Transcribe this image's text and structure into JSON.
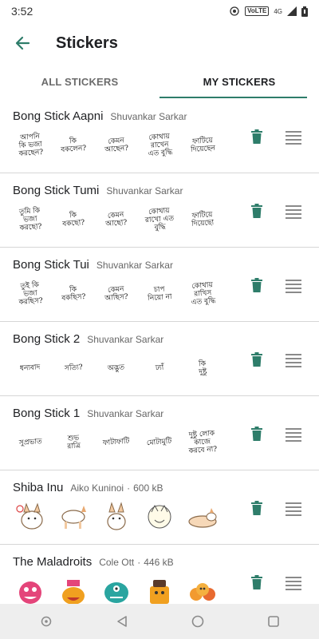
{
  "status_bar": {
    "time": "3:52",
    "volte": "VoLTE",
    "net": "4G"
  },
  "app_bar": {
    "title": "Stickers"
  },
  "tabs": [
    {
      "label": "ALL STICKERS",
      "active": false
    },
    {
      "label": "MY STICKERS",
      "active": true
    }
  ],
  "colors": {
    "accent": "#2e7d6a",
    "delete": "#2e7d6a",
    "divider": "#d6d6d6",
    "nav_bg": "#eeeeee"
  },
  "packs": [
    {
      "name": "Bong Stick Aapni",
      "author": "Shuvankar Sarkar",
      "size": "",
      "stickers": [
        "আপনি\nকি ভজা\nকরছেন?",
        "কি\nবকলেন?",
        "কেমন\nআছেন?",
        "কোথায়\nরাখেন\nএত বুদ্ধি",
        "ফাটিয়ে\nদিয়েছেন"
      ]
    },
    {
      "name": "Bong Stick Tumi",
      "author": "Shuvankar Sarkar",
      "size": "",
      "stickers": [
        "তুমি কি\nভজা\nকরছো?",
        "কি\nবকছো?",
        "কেমন\nআছো?",
        "কোথায়\nরাখো এত\nবুদ্ধি",
        "ফাটিয়ে\nদিয়েছো"
      ]
    },
    {
      "name": "Bong Stick Tui",
      "author": "Shuvankar Sarkar",
      "size": "",
      "stickers": [
        "তুই কি\nভজা\nকরছিস?",
        "কি\nবকছিস?",
        "কেমন\nআছিস?",
        "চাপ\nনিয়ো না",
        "কোথায়\nরাখিস\nএত বুদ্ধি"
      ]
    },
    {
      "name": "Bong Stick 2",
      "author": "Shuvankar Sarkar",
      "size": "",
      "stickers": [
        "ধন্যবাদ",
        "সত্যি?",
        "অদ্ভুত",
        "ঢ্যাঁ",
        "কি\nদুষ্টু"
      ]
    },
    {
      "name": "Bong Stick 1",
      "author": "Shuvankar Sarkar",
      "size": "",
      "stickers": [
        "সুপ্রভাত",
        "শুভ\nরাত্রি",
        "ফাটাফাটি",
        "মোটামুটি",
        "দুষ্টু লোক\nকাজে\nকরবে না?"
      ]
    },
    {
      "name": "Shiba Inu",
      "author": "Aiko Kuninoi",
      "size": "600 kB",
      "stickers": [
        "dog-surprised",
        "dog-standing",
        "dog-sitting",
        "dog-sketch",
        "dog-lying"
      ]
    },
    {
      "name": "The Maladroits",
      "author": "Cole Ott",
      "size": "446 kB",
      "stickers": [
        "pink-monster",
        "ha-ha-monster",
        "teal-monster",
        "orange-bucket-monster",
        "crowd-monster"
      ]
    }
  ],
  "icons": {
    "back": "arrow-back-icon",
    "delete": "trash-icon",
    "drag": "drag-handle-icon",
    "nav_back": "triangle-back-icon",
    "nav_home": "circle-home-icon",
    "nav_recents": "square-recents-icon"
  }
}
